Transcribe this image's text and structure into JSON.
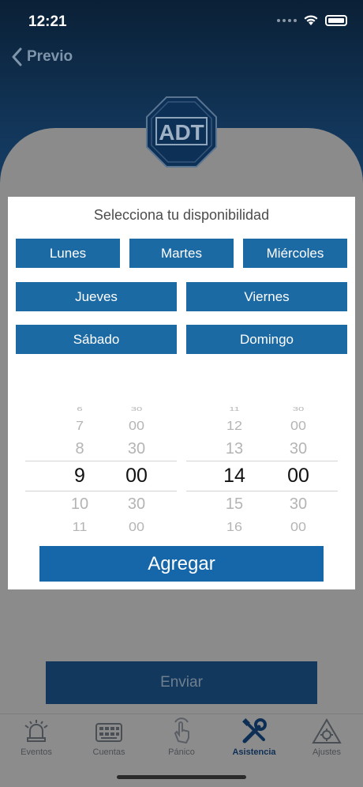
{
  "status_bar": {
    "time": "12:21"
  },
  "nav": {
    "back_label": "Previo"
  },
  "logo": {
    "text": "ADT"
  },
  "modal": {
    "title": "Selecciona tu disponibilidad",
    "days": [
      "Lunes",
      "Martes",
      "Miércoles",
      "Jueves",
      "Viernes",
      "Sábado",
      "Domingo"
    ],
    "start_picker": {
      "hours": [
        "6",
        "7",
        "8",
        "9",
        "10",
        "11"
      ],
      "minutes": [
        "30",
        "00",
        "30",
        "00",
        "30",
        "00"
      ],
      "selected_hour": "9",
      "selected_minute": "00"
    },
    "end_picker": {
      "hours": [
        "11",
        "12",
        "13",
        "14",
        "15",
        "16"
      ],
      "minutes": [
        "30",
        "00",
        "30",
        "00",
        "30",
        "00"
      ],
      "selected_hour": "14",
      "selected_minute": "00"
    },
    "add_label": "Agregar"
  },
  "send_label": "Enviar",
  "tabs": [
    {
      "label": "Eventos",
      "icon": "alarm-bell-icon"
    },
    {
      "label": "Cuentas",
      "icon": "keypad-icon"
    },
    {
      "label": "Pánico",
      "icon": "panic-hand-icon"
    },
    {
      "label": "Asistencia",
      "icon": "tools-icon",
      "active": true
    },
    {
      "label": "Ajustes",
      "icon": "warning-gear-icon"
    }
  ],
  "colors": {
    "header_navy": "#13385d",
    "day_button_blue": "#1c6aa4",
    "add_button_blue": "#1667aa",
    "overlay_gray": "#8b8b8b"
  }
}
